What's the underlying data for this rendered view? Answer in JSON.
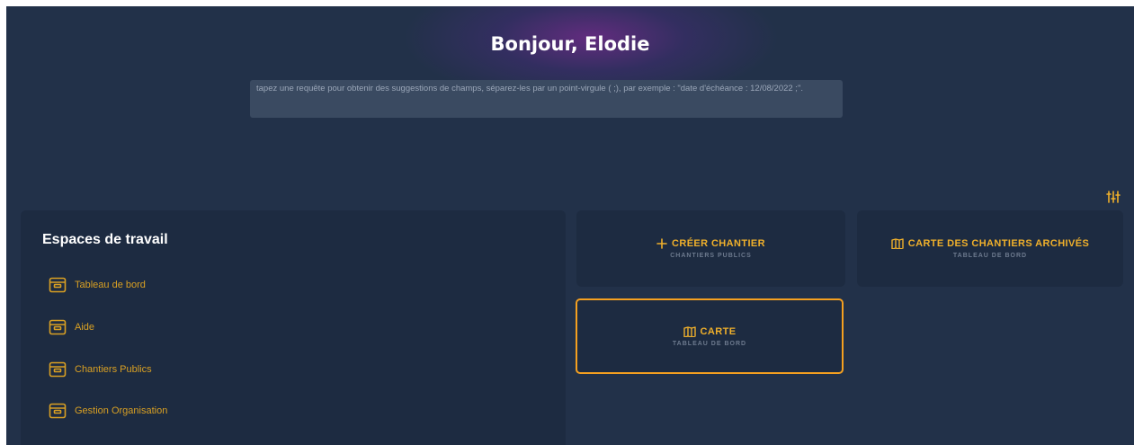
{
  "header": {
    "greeting": "Bonjour, Elodie",
    "query_placeholder": "tapez une requête pour obtenir des suggestions de champs, séparez-les par un point-virgule ( ;), par exemple : \"date d'échéance : 12/08/2022 ;\"."
  },
  "workspaces": {
    "title": "Espaces de travail",
    "items": [
      {
        "label": "Tableau de bord",
        "icon": "archive-box-icon"
      },
      {
        "label": "Aide",
        "icon": "archive-box-icon"
      },
      {
        "label": "Chantiers Publics",
        "icon": "archive-box-icon"
      },
      {
        "label": "Gestion Organisation",
        "icon": "archive-box-icon"
      }
    ]
  },
  "cards": [
    {
      "title": "CRÉER CHANTIER",
      "subtitle": "CHANTIERS PUBLICS",
      "icon": "plus-icon"
    },
    {
      "title": "CARTE DES CHANTIERS ARCHIVÉS",
      "subtitle": "TABLEAU DE BORD",
      "icon": "map-icon"
    },
    {
      "title": "CARTE",
      "subtitle": "TABLEAU DE BORD",
      "icon": "map-icon",
      "focused": true
    }
  ],
  "colors": {
    "background": "#223149",
    "panel": "#1d2b41",
    "accent": "#f0b02b",
    "focus_border": "#f5a020"
  }
}
